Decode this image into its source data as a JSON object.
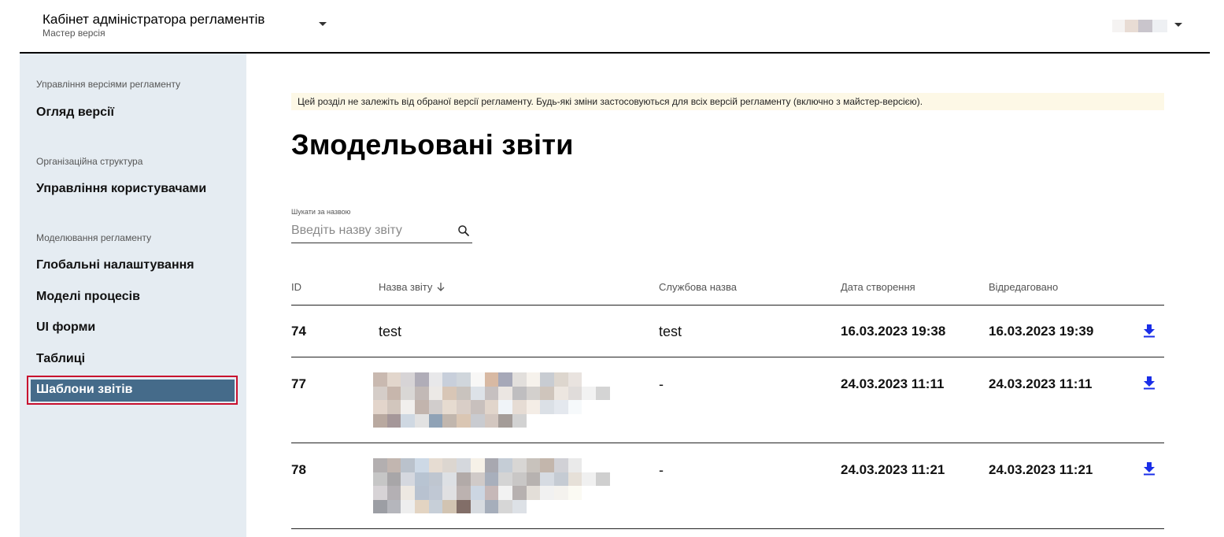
{
  "header": {
    "title": "Кабінет адміністратора регламентів",
    "subtitle": "Мастер версія"
  },
  "sidebar": {
    "sections": [
      {
        "label": "Управління версіями регламенту",
        "items": [
          {
            "label": "Огляд версії"
          }
        ]
      },
      {
        "label": "Організаційна структура",
        "items": [
          {
            "label": "Управління користувачами"
          }
        ]
      },
      {
        "label": "Моделювання регламенту",
        "items": [
          {
            "label": "Глобальні налаштування"
          },
          {
            "label": "Моделі процесів"
          },
          {
            "label": "UI форми"
          },
          {
            "label": "Таблиці"
          },
          {
            "label": "Шаблони звітів",
            "active": true
          }
        ]
      }
    ]
  },
  "main": {
    "notice": "Цей розділ не залежіть від обраної версії регламенту. Будь-які зміни застосовуються для всіх версій регламенту (включно з майстер-версією).",
    "title": "Змодельовані звіти",
    "search": {
      "label": "Шукати за назвою",
      "placeholder": "Введіть назву звіту"
    },
    "table": {
      "columns": [
        "ID",
        "Назва звіту",
        "Службова назва",
        "Дата створення",
        "Відредаговано"
      ],
      "rows": [
        {
          "id": "74",
          "name": "test",
          "service_name": "test",
          "created": "16.03.2023 19:38",
          "edited": "16.03.2023 19:39"
        },
        {
          "id": "77",
          "name": "",
          "service_name": "-",
          "created": "24.03.2023 11:11",
          "edited": "24.03.2023 11:11"
        },
        {
          "id": "78",
          "name": "",
          "service_name": "-",
          "created": "24.03.2023 11:21",
          "edited": "24.03.2023 11:21"
        }
      ]
    }
  },
  "icons": {
    "search": "search-icon",
    "sort": "arrow-down-icon",
    "download": "download-icon",
    "caret": "caret-down-icon"
  },
  "colors": {
    "sidebar_bg": "#e5ecf2",
    "active_item_bg": "#456b8a",
    "active_outline": "#c8102e",
    "notice_bg": "#fdf8e6",
    "download_icon": "#1a2ee8"
  }
}
